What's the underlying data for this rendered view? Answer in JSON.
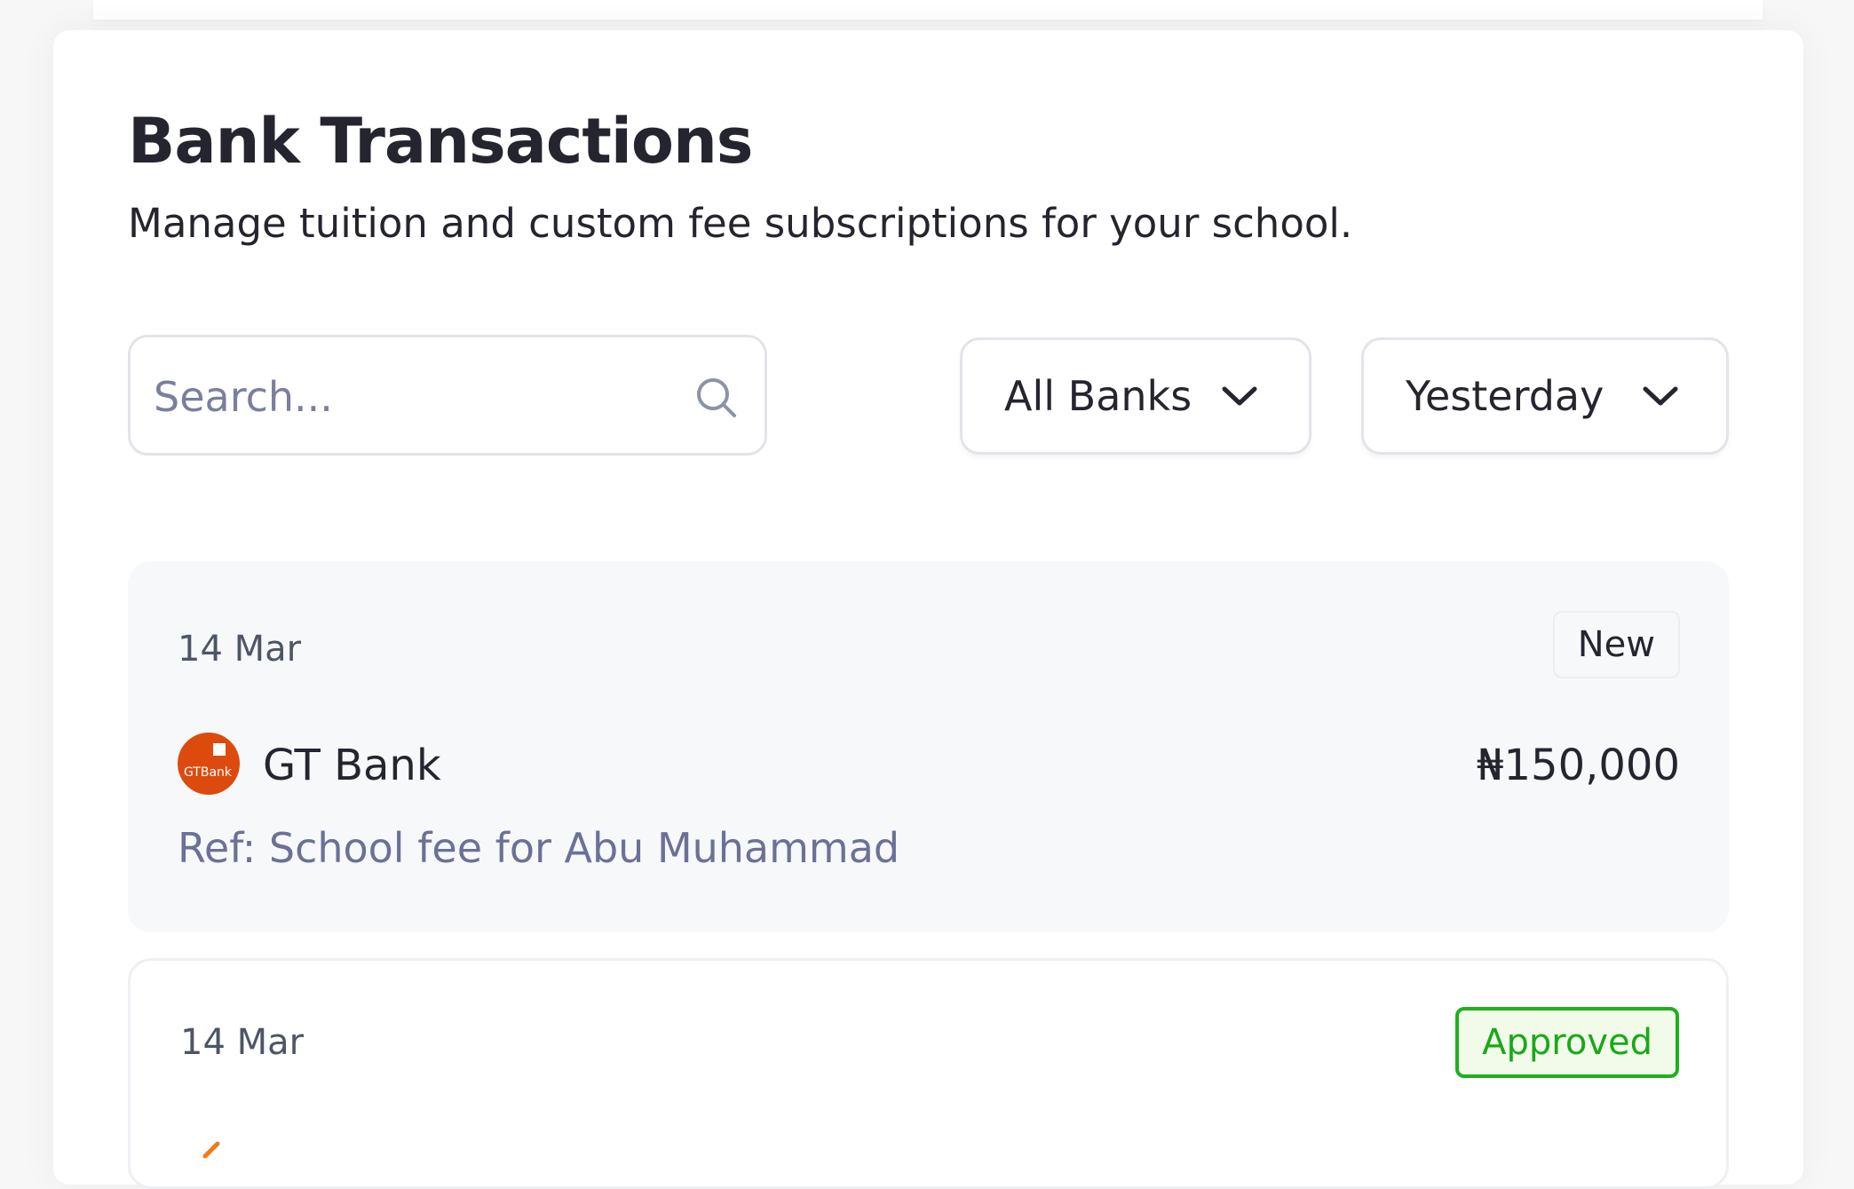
{
  "header": {
    "title": "Bank Transactions",
    "subtitle": "Manage tuition and custom fee subscriptions for your school."
  },
  "filters": {
    "search_placeholder": "Search...",
    "search_value": "",
    "bank_select": "All Banks",
    "date_select": "Yesterday"
  },
  "colors": {
    "approved": "#1aa81a",
    "gtbank_brand": "#dc4b0d",
    "reference_text": "#6b7196"
  },
  "transactions": [
    {
      "date": "14 Mar",
      "status": "New",
      "bank": "GT Bank",
      "bank_logo_text": "GTBank",
      "amount": "₦150,000",
      "reference": "Ref: School fee for Abu Muhammad"
    },
    {
      "date": "14 Mar",
      "status": "Approved"
    }
  ]
}
